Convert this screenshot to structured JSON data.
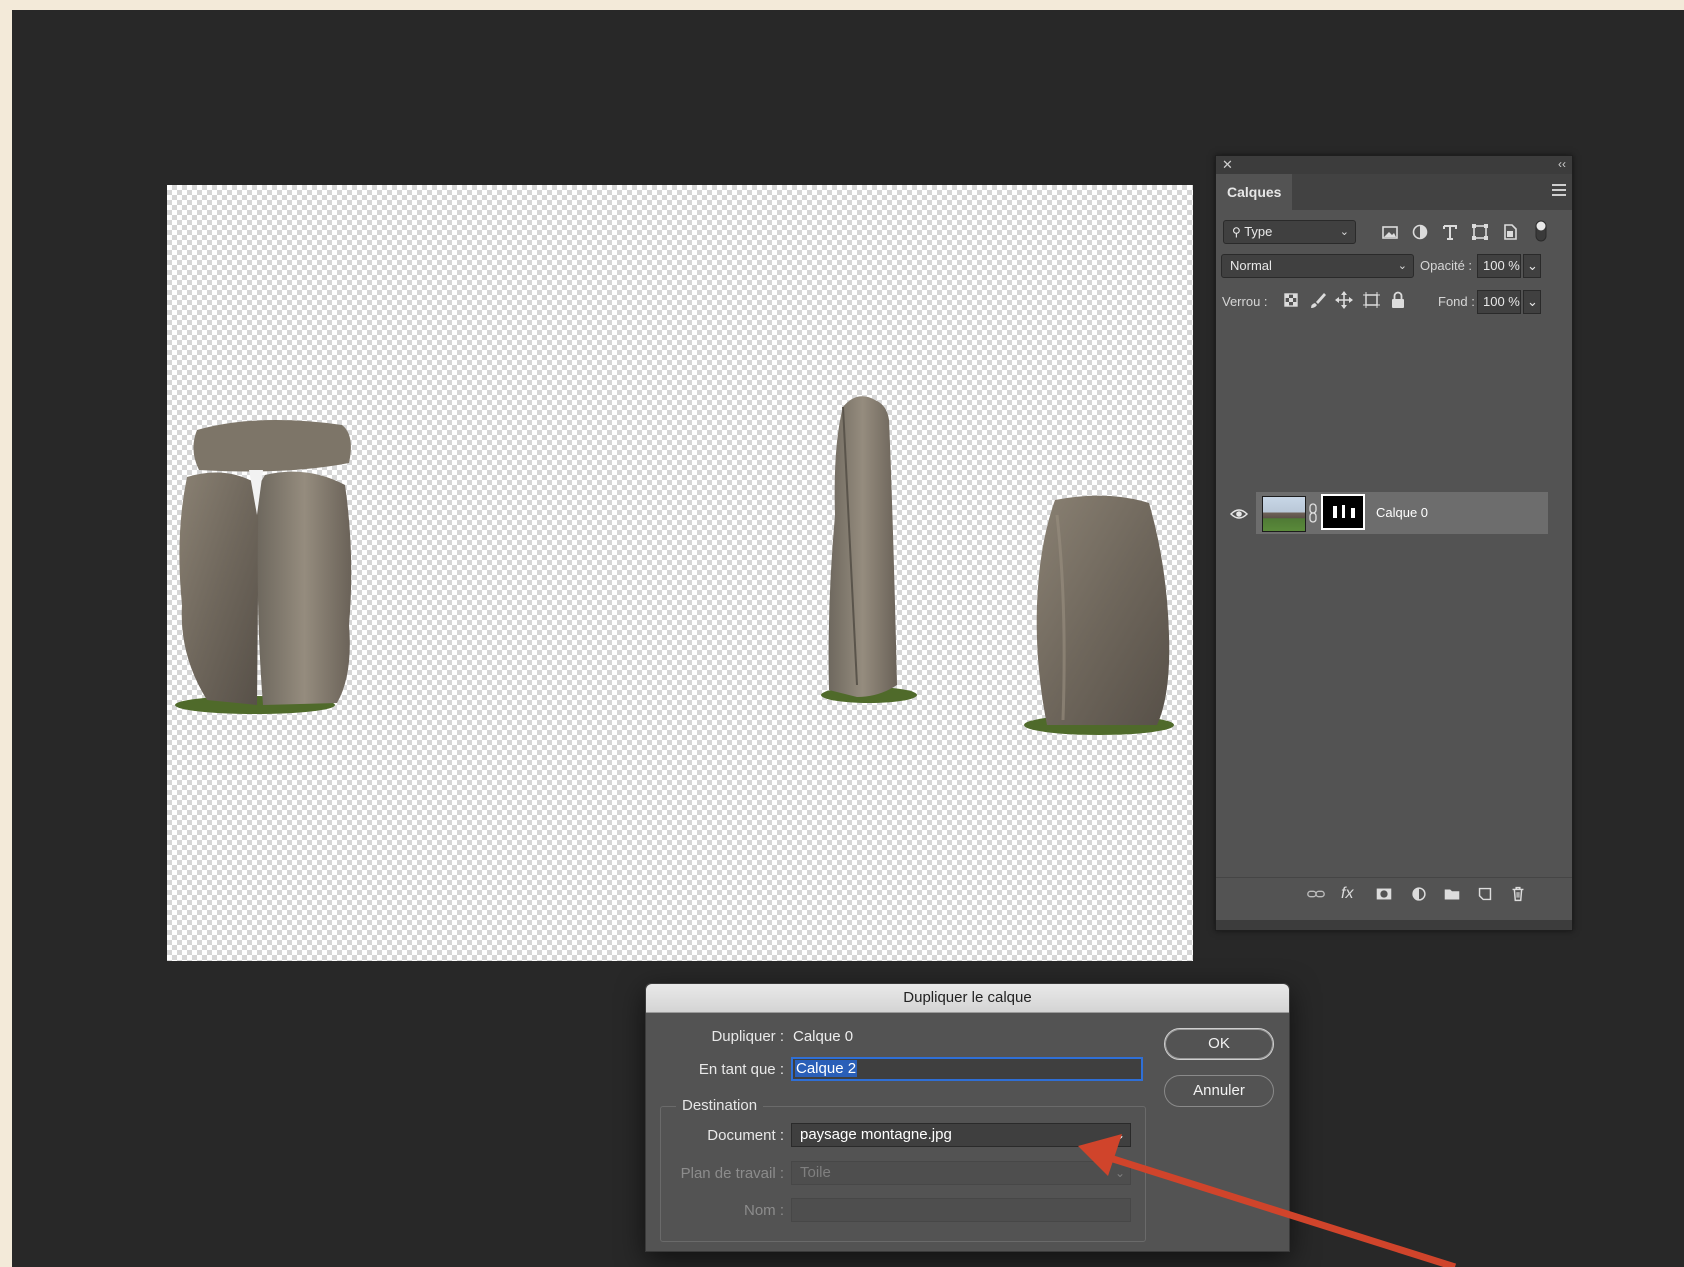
{
  "layers_panel": {
    "tab_label": "Calques",
    "filter": {
      "selected": "Type",
      "icons": [
        "image-filter-icon",
        "adjustment-filter-icon",
        "type-filter-icon",
        "shape-filter-icon",
        "smart-object-filter-icon"
      ]
    },
    "blend_mode": "Normal",
    "opacity_label": "Opacité :",
    "opacity_value": "100 %",
    "lock_label": "Verrou :",
    "fill_label": "Fond :",
    "fill_value": "100 %",
    "layers": [
      {
        "name": "Calque 0",
        "visible": true,
        "has_mask": true
      }
    ]
  },
  "dialog": {
    "title": "Dupliquer le calque",
    "duplicate_label": "Dupliquer :",
    "duplicate_value": "Calque 0",
    "as_label": "En tant que :",
    "as_value": "Calque 2",
    "destination_legend": "Destination",
    "document_label": "Document :",
    "document_value": "paysage montagne.jpg",
    "artboard_label": "Plan de travail :",
    "artboard_value": "Toile",
    "name_label": "Nom :",
    "name_value": "",
    "ok_label": "OK",
    "cancel_label": "Annuler"
  },
  "annotation": {
    "arrow_color": "#d0442b"
  }
}
